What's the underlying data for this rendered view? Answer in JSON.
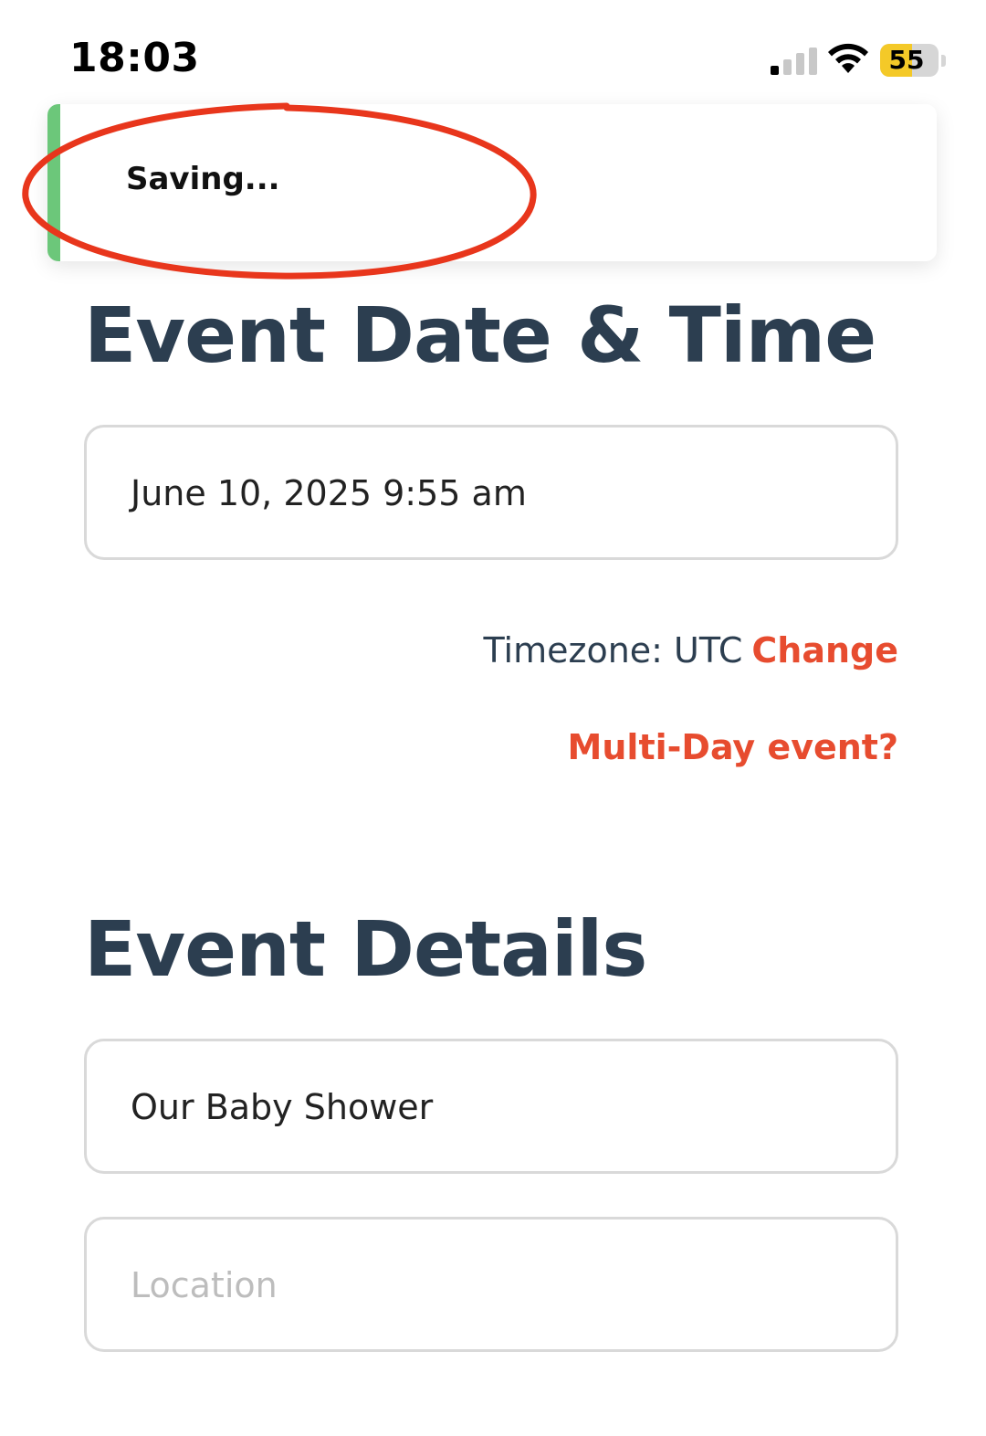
{
  "status_bar": {
    "time": "18:03",
    "battery_level": "55",
    "battery_fraction": 0.55,
    "signal_bars_active": 1,
    "signal_bars_total": 4
  },
  "toast": {
    "message": "Saving...",
    "accent_color": "#6cc77a"
  },
  "annotation": {
    "color": "#e8361c"
  },
  "event_date_section": {
    "title": "Event Date & Time",
    "date_value": "June 10, 2025 9:55 am",
    "timezone_label": "Timezone: UTC",
    "timezone_change_label": "Change",
    "multi_day_label": "Multi-Day event?"
  },
  "event_details_section": {
    "title": "Event Details",
    "name_value": "Our Baby Shower",
    "location_placeholder": "Location"
  },
  "colors": {
    "heading": "#2c3e50",
    "link": "#e74c2f",
    "border": "#d9d9d9"
  }
}
